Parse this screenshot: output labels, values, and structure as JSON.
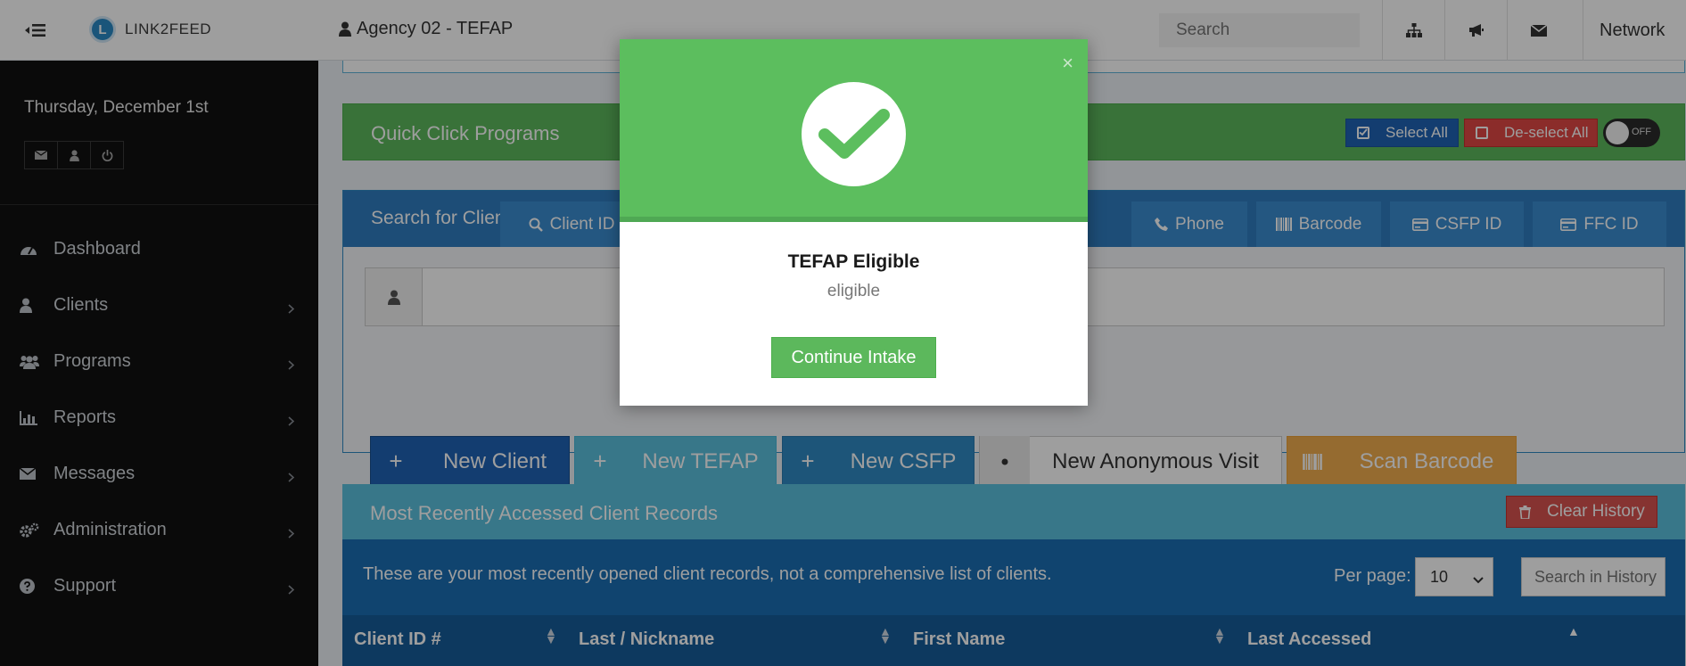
{
  "topbar": {
    "logo_text": "LINK2FEED",
    "logo_letter": "L",
    "agency": "Agency 02 - TEFAP",
    "search_placeholder": "Search",
    "network": "Network"
  },
  "sidebar": {
    "date": "Thursday, December 1st",
    "items": [
      {
        "label": "Dashboard",
        "icon": "dashboard-icon"
      },
      {
        "label": "Clients",
        "icon": "user-icon"
      },
      {
        "label": "Programs",
        "icon": "users-icon"
      },
      {
        "label": "Reports",
        "icon": "bar-chart-icon"
      },
      {
        "label": "Messages",
        "icon": "envelope-icon"
      },
      {
        "label": "Administration",
        "icon": "gears-icon"
      },
      {
        "label": "Support",
        "icon": "question-circle-icon"
      }
    ]
  },
  "quick_click": {
    "title": "Quick Click Programs",
    "select_all": "Select All",
    "deselect_all": "De-select All",
    "toggle_state": "OFF"
  },
  "search_clients": {
    "title": "Search for Clients By:",
    "tabs": [
      "Client ID",
      "Phone",
      "Barcode",
      "CSFP ID",
      "FFC ID"
    ]
  },
  "actions": {
    "new_client": "New Client",
    "new_tefap": "New TEFAP",
    "new_csfp": "New CSFP",
    "new_anonymous": "New Anonymous Visit",
    "scan_barcode": "Scan Barcode"
  },
  "recent": {
    "title": "Most Recently Accessed Client Records",
    "clear_history": "Clear History",
    "note": "These are your most recently opened client records, not a comprehensive list of clients.",
    "per_page_label": "Per page:",
    "per_page_value": "10",
    "search_placeholder": "Search in History",
    "columns": [
      "Client ID #",
      "Last / Nickname",
      "First Name",
      "Last Accessed"
    ]
  },
  "modal": {
    "title": "TEFAP Eligible",
    "subtitle": "eligible",
    "button": "Continue Intake",
    "close": "×"
  },
  "colors": {
    "success": "#5cb85c",
    "primary": "#2f7dc0",
    "danger": "#d9534f",
    "warning": "#f0ad4e",
    "info": "#5bc0de"
  }
}
